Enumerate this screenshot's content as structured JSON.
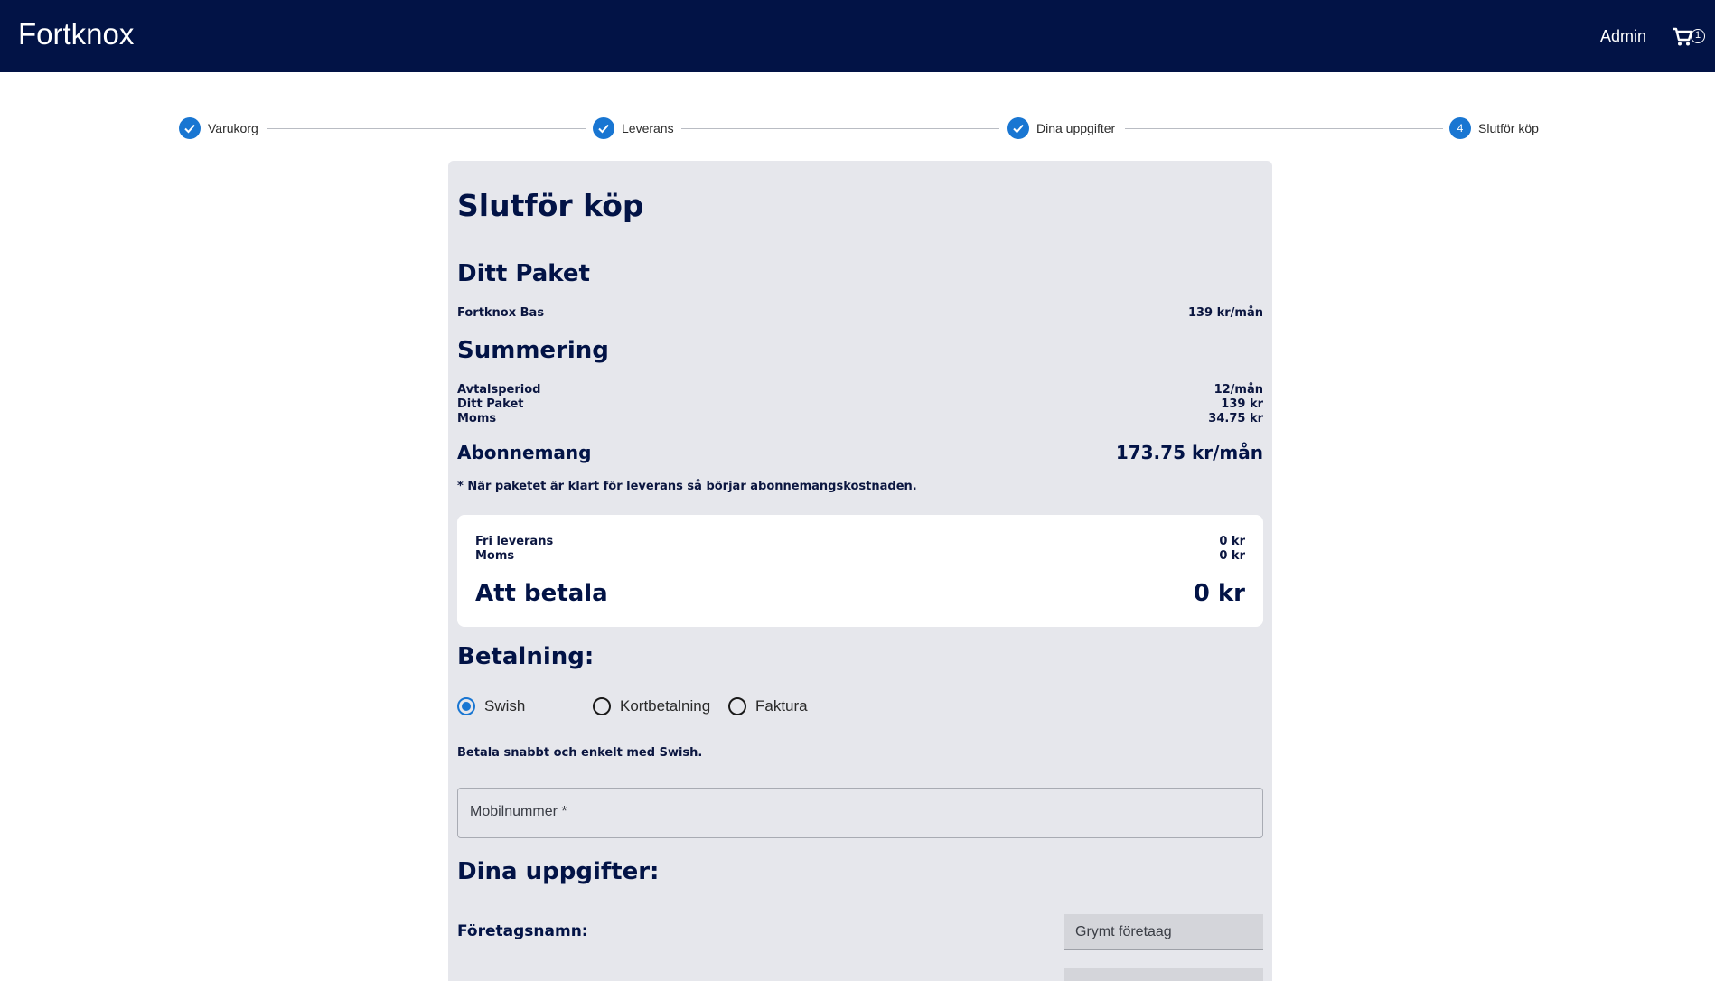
{
  "header": {
    "brand": "Fortknox",
    "admin_label": "Admin",
    "cart_count": "1"
  },
  "stepper": {
    "steps": [
      {
        "label": "Varukorg",
        "state": "done"
      },
      {
        "label": "Leverans",
        "state": "done"
      },
      {
        "label": "Dina uppgifter",
        "state": "done"
      },
      {
        "label": "Slutför köp",
        "state": "active",
        "number": "4"
      }
    ]
  },
  "checkout": {
    "title": "Slutför köp",
    "package_heading": "Ditt Paket",
    "package_name": "Fortknox Bas",
    "package_price": "139 kr/mån",
    "summary_heading": "Summering",
    "summary_rows": [
      {
        "label": "Avtalsperiod",
        "value": "12/mån"
      },
      {
        "label": "Ditt Paket",
        "value": "139 kr"
      },
      {
        "label": "Moms",
        "value": "34.75 kr"
      }
    ],
    "subscription_label": "Abonnemang",
    "subscription_value": "173.75 kr/mån",
    "note": "* När paketet är klart för leverans så börjar abonnemangskostnaden.",
    "pay_rows": [
      {
        "label": "Fri leverans",
        "value": "0 kr"
      },
      {
        "label": "Moms",
        "value": "0 kr"
      }
    ],
    "to_pay_label": "Att betala",
    "to_pay_value": "0 kr",
    "payment_heading": "Betalning:",
    "payment_options": [
      {
        "label": "Swish",
        "selected": true
      },
      {
        "label": "Kortbetalning",
        "selected": false
      },
      {
        "label": "Faktura",
        "selected": false
      }
    ],
    "swish_info": "Betala snabbt och enkelt med Swish.",
    "mobile_placeholder": "Mobilnummer *",
    "details_heading": "Dina uppgifter:",
    "company_label": "Företagsnamn:",
    "company_value": "Grymt företaag"
  },
  "colors": {
    "header_bg": "#021346",
    "accent": "#1976d2",
    "card_bg": "#e6e7ec"
  }
}
